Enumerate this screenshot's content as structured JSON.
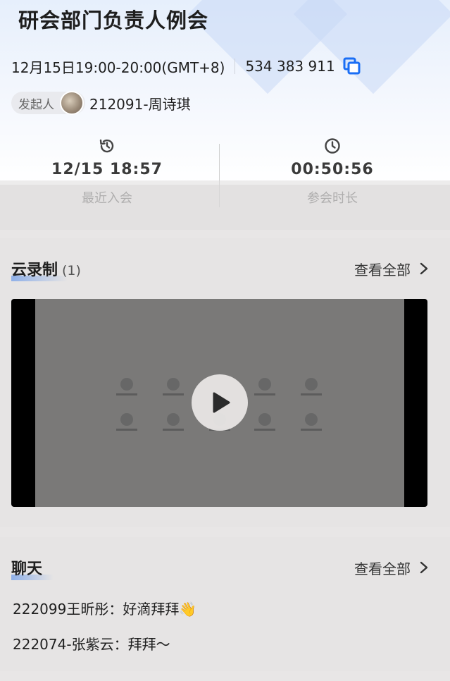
{
  "meeting": {
    "title": "研会部门负责人例会",
    "time": "12月15日19:00-20:00(GMT+8)",
    "meeting_id": "534 383 911",
    "host_label": "发起人",
    "host_name": "212091-周诗琪"
  },
  "stats": {
    "last_join_time": "12/15 18:57",
    "last_join_label": "最近入会",
    "duration": "00:50:56",
    "duration_label": "参会时长"
  },
  "recording": {
    "title": "云录制",
    "count": "(1)",
    "view_all": "查看全部"
  },
  "chat": {
    "title": "聊天",
    "view_all": "查看全部",
    "messages": [
      {
        "text": "222099王昕彤：好滴拜拜👋"
      },
      {
        "text": "222074-张紫云：拜拜～"
      }
    ]
  },
  "colors": {
    "accent": "#1a6ef5",
    "header_bg": "#e6effc",
    "page_bg": "#e8e6e6",
    "video_bg": "#7a7978"
  },
  "icons": [
    "copy-icon",
    "history-icon",
    "clock-icon",
    "chevron-right-icon",
    "play-icon"
  ]
}
